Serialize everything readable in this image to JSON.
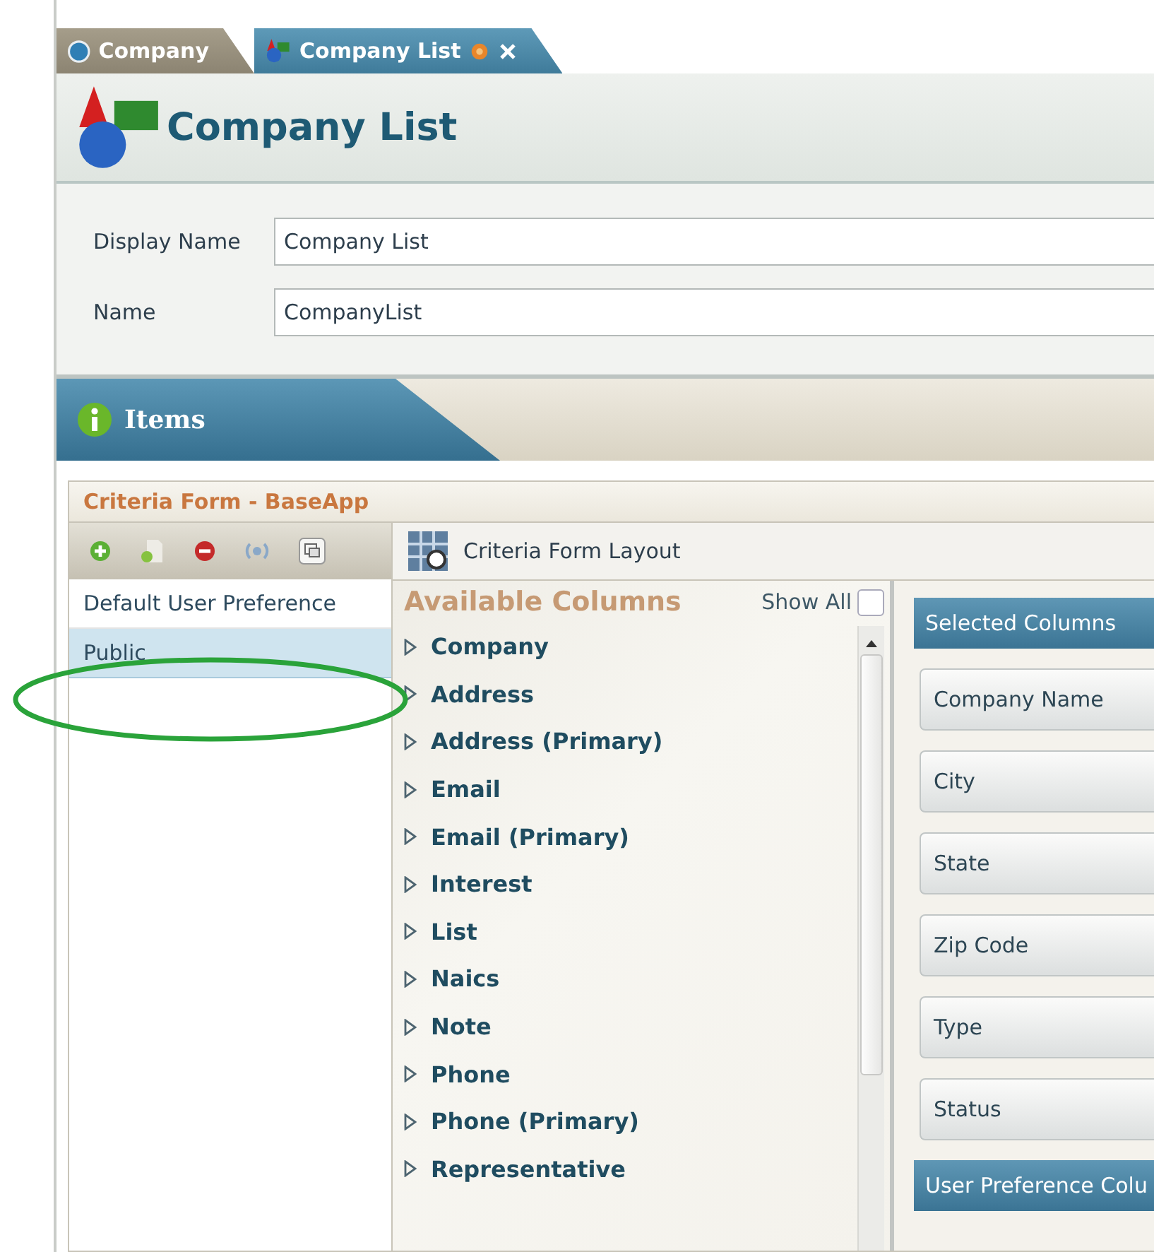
{
  "tabs": [
    {
      "label": "Company",
      "selected": false,
      "closable": false
    },
    {
      "label": "Company List",
      "selected": true,
      "closable": true
    }
  ],
  "header": {
    "title": "Company List"
  },
  "form": {
    "fields": [
      {
        "label": "Display Name",
        "value": "Company List"
      },
      {
        "label": "Name",
        "value": "CompanyList"
      }
    ]
  },
  "items_section": {
    "title": "Items"
  },
  "criteria_panel": {
    "title": "Criteria Form - BaseApp",
    "preferences": [
      {
        "label": "Default User Preference",
        "selected": false
      },
      {
        "label": "Public",
        "selected": true
      }
    ],
    "layout_title": "Criteria Form Layout",
    "available": {
      "heading": "Available Columns",
      "show_all": {
        "label": "Show All",
        "checked": false
      },
      "columns": [
        "Company",
        "Address",
        "Address (Primary)",
        "Email",
        "Email (Primary)",
        "Interest",
        "List",
        "Naics",
        "Note",
        "Phone",
        "Phone (Primary)",
        "Representative"
      ]
    },
    "selected": {
      "heading": "Selected Columns",
      "columns": [
        "Company Name",
        "City",
        "State",
        "Zip Code",
        "Type",
        "Status"
      ]
    },
    "user_preference": {
      "heading": "User Preference Colu"
    }
  }
}
